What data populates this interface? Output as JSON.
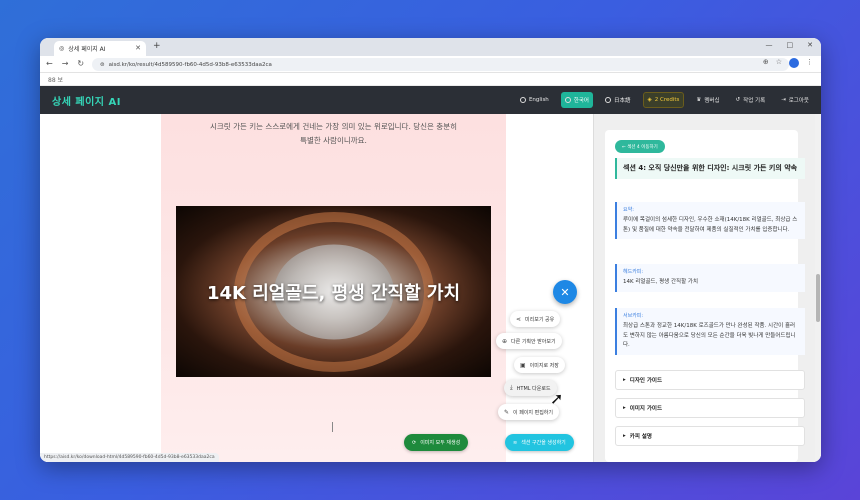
{
  "browser": {
    "tab_title": "상세 페이지 AI",
    "new_tab": "+",
    "url": "aisd.kr/ko/result/4d589590-fb60-4d5d-93b8-e63533daa2ca",
    "bookmarks_label": "88  보",
    "window_controls": [
      "—",
      "□",
      "✕"
    ],
    "status_url": "https://aisd.kr/ko/download-html/4d589590-fb60-4d5d-93b8-e63533daa2ca"
  },
  "header": {
    "brand": "상세 페이지 AI",
    "items": [
      {
        "label": "English",
        "icon": "globe-icon"
      },
      {
        "label": "한국어",
        "icon": "globe-icon",
        "active": true
      },
      {
        "label": "日本語",
        "icon": "globe-icon"
      },
      {
        "label": "2 Credits",
        "icon": "coin-icon"
      },
      {
        "label": "멤버십",
        "icon": "crown-icon"
      },
      {
        "label": "작업 기록",
        "icon": "history-icon"
      },
      {
        "label": "로그아웃",
        "icon": "logout-icon"
      }
    ]
  },
  "page": {
    "quote_line1": "시크릿 가든 키는 스스로에게 건네는 가장 의미 있는 위로입니다. 당신은 충분히",
    "quote_line2": "특별한 사람이니까요.",
    "hero_title": "14K 리얼골드, 평생 간직할 가치"
  },
  "fab_menu": {
    "close_icon": "✕",
    "items": [
      {
        "label": "미리보기 공유",
        "icon": "share-icon"
      },
      {
        "label": "다른 기획안 받아보기",
        "icon": "plus-icon"
      },
      {
        "label": "이미지로 저장",
        "icon": "camera-icon"
      },
      {
        "label": "HTML 다운로드",
        "icon": "download-icon"
      },
      {
        "label": "이 페이지 편집하기",
        "icon": "edit-icon"
      }
    ],
    "bottom_buttons": [
      {
        "label": "이미지 모두 재생성",
        "icon": "refresh-icon"
      },
      {
        "label": "섹션 구간을 생성하기",
        "icon": "layers-icon"
      }
    ]
  },
  "right_panel": {
    "section_badge": "← 섹션 4 이동하기",
    "section_title": "섹션 4: 오직 당신만을 위한 디자인: 시크릿 가든 키의 약속",
    "fields": [
      {
        "label": "요약:",
        "text": "루이에 목걸이의 섬세한 디자인, 우수한 소재(14K/18K 리얼골드, 최상급 스톤) 및 품질에 대한 약속을 전달하여 제품의 실질적인 가치를 입증합니다."
      },
      {
        "label": "헤드카피:",
        "text": "14K 리얼골드, 평생 간직할 가치"
      },
      {
        "label": "서브카피:",
        "text": "최상급 스톤과 정교한 14K/18K 로즈골드가 만나 완성된 작품. 시간이 흘러도 변하지 않는 아름다움으로 당신의 모든 순간을 더욱 빛나게 만들어드립니다."
      }
    ],
    "accordions": [
      "디자인 가이드",
      "이미지 가이드",
      "카피 설명"
    ]
  },
  "colors": {
    "accent_teal": "#2fb89c",
    "fab_blue": "#1e88e5",
    "header_dark": "#2b2f36",
    "credits_gold": "#f3c93a"
  }
}
